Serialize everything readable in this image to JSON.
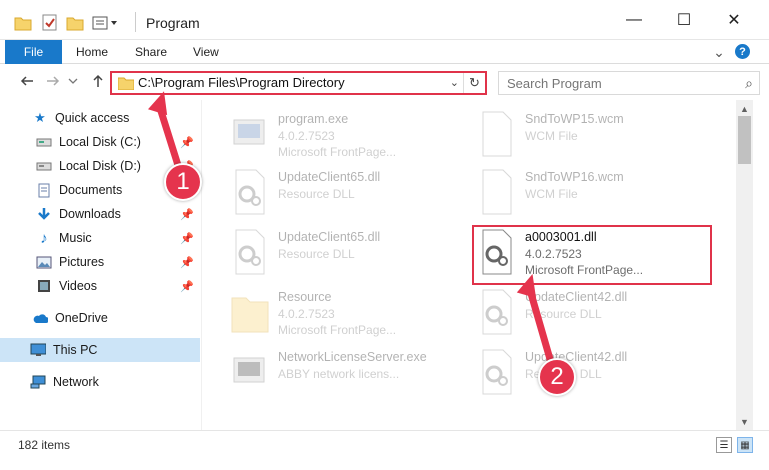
{
  "window": {
    "title": "Program",
    "minimize_glyph": "—",
    "maximize_glyph": "☐",
    "close_glyph": "✕"
  },
  "ribbon": {
    "file": "File",
    "home": "Home",
    "share": "Share",
    "view": "View",
    "expand_glyph": "⌄",
    "help_glyph": "?"
  },
  "address": {
    "path": "C:\\Program Files\\Program Directory",
    "search_placeholder": "Search Program"
  },
  "sidebar": {
    "items": [
      {
        "label": "Quick access",
        "icon": "star-icon",
        "pinned": false
      },
      {
        "label": "Local Disk (C:)",
        "icon": "drive-icon",
        "pinned": true
      },
      {
        "label": "Local Disk (D:)",
        "icon": "drive-icon",
        "pinned": true
      },
      {
        "label": "Documents",
        "icon": "documents-icon",
        "pinned": true
      },
      {
        "label": "Downloads",
        "icon": "downloads-icon",
        "pinned": true
      },
      {
        "label": "Music",
        "icon": "music-icon",
        "pinned": true
      },
      {
        "label": "Pictures",
        "icon": "pictures-icon",
        "pinned": true
      },
      {
        "label": "Videos",
        "icon": "videos-icon",
        "pinned": true
      },
      {
        "label": "OneDrive",
        "icon": "cloud-icon",
        "pinned": false
      },
      {
        "label": "This PC",
        "icon": "pc-icon",
        "pinned": false
      },
      {
        "label": "Network",
        "icon": "network-icon",
        "pinned": false
      }
    ]
  },
  "files": [
    {
      "name": "program.exe",
      "line2": "4.0.2.7523",
      "line3": "Microsoft FrontPage...",
      "icon": "exe-icon"
    },
    {
      "name": "SndToWP15.wcm",
      "line2": "WCM File",
      "line3": "",
      "icon": "document-icon"
    },
    {
      "name": "UpdateClient65.dll",
      "line2": "Resource DLL",
      "line3": "",
      "icon": "dll-gear-icon"
    },
    {
      "name": "SndToWP16.wcm",
      "line2": "WCM File",
      "line3": "",
      "icon": "document-icon"
    },
    {
      "name": "UpdateClient65.dll",
      "line2": "Resource DLL",
      "line3": "",
      "icon": "dll-gear-icon"
    },
    {
      "name": "a0003001.dll",
      "line2": "4.0.2.7523",
      "line3": "Microsoft FrontPage...",
      "icon": "dll-gear-icon"
    },
    {
      "name": "Resource",
      "line2": "4.0.2.7523",
      "line3": "Microsoft FrontPage...",
      "icon": "folder-icon"
    },
    {
      "name": "UpdateClient42.dll",
      "line2": "Resource DLL",
      "line3": "",
      "icon": "dll-gear-icon"
    },
    {
      "name": "NetworkLicenseServer.exe",
      "line2": "ABBY network licens...",
      "line3": "",
      "icon": "exe-icon"
    },
    {
      "name": "UpdateClient42.dll",
      "line2": "Resource DLL",
      "line3": "",
      "icon": "dll-gear-icon"
    }
  ],
  "status": {
    "item_count": "182 items"
  },
  "callouts": {
    "one": "1",
    "two": "2"
  },
  "colors": {
    "accent_blue": "#1979ca",
    "highlight_red": "#e0334a",
    "selection": "#cce4f7"
  }
}
